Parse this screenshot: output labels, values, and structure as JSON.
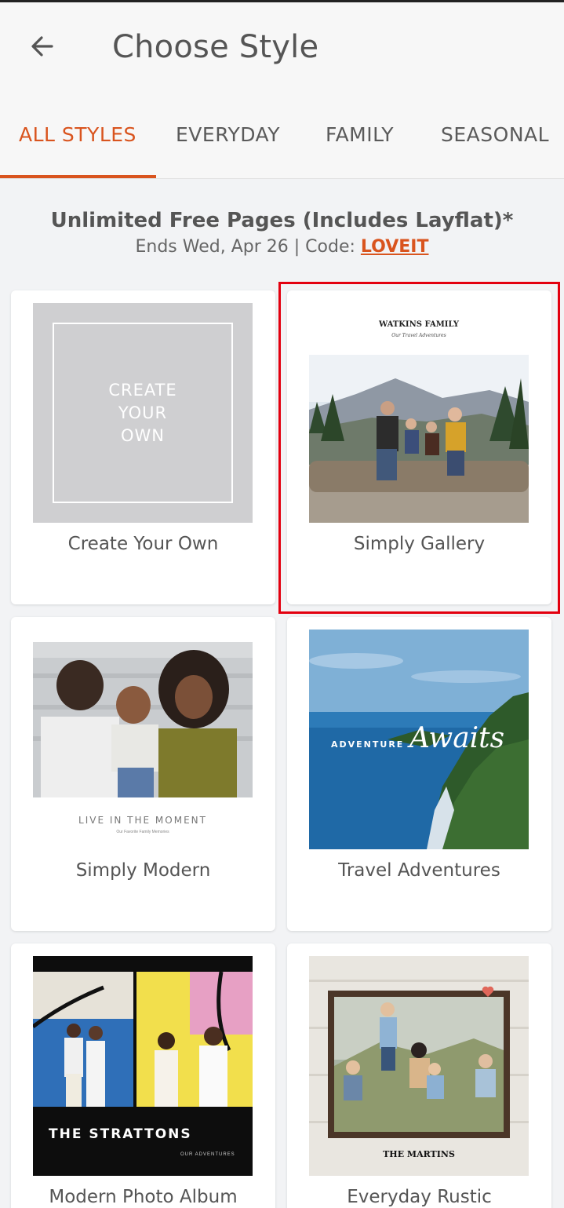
{
  "header": {
    "title": "Choose Style",
    "back_icon": "arrow-left-icon"
  },
  "tabs": [
    {
      "label": "ALL STYLES",
      "active": true
    },
    {
      "label": "EVERYDAY",
      "active": false
    },
    {
      "label": "FAMILY",
      "active": false
    },
    {
      "label": "SEASONAL",
      "active": false
    }
  ],
  "promo": {
    "title": "Unlimited Free Pages (Includes Layflat)*",
    "subtitle": "Ends Wed, Apr 26 | Code:",
    "code": "LOVEIT"
  },
  "styles": [
    {
      "label": "Create Your Own",
      "thumb_text": [
        "CREATE",
        "YOUR",
        "OWN"
      ]
    },
    {
      "label": "Simply Gallery",
      "thumb_title": "WATKINS FAMILY",
      "thumb_subtitle": "Our Travel Adventures",
      "highlighted": true
    },
    {
      "label": "Simply Modern",
      "thumb_title": "LIVE IN THE MOMENT",
      "thumb_subtitle": "Our Favorite Family Memories"
    },
    {
      "label": "Travel Adventures",
      "thumb_word1": "ADVENTURE",
      "thumb_word2": "Awaits"
    },
    {
      "label": "Modern Photo Album",
      "thumb_title": "THE STRATTONS",
      "thumb_subtitle": "OUR ADVENTURES"
    },
    {
      "label": "Everyday Rustic",
      "thumb_title": "THE MARTINS"
    }
  ],
  "colors": {
    "accent": "#d9541e",
    "highlight_border": "#e3000f",
    "background": "#f2f3f5"
  }
}
